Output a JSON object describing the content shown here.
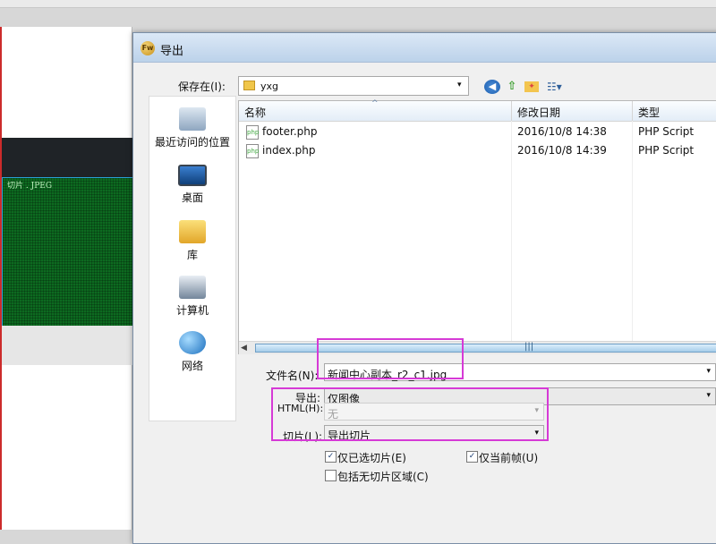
{
  "app": {
    "slice_label": "切片 . JPEG"
  },
  "dialog": {
    "title": "导出",
    "logo_text": "Fw",
    "save_in": {
      "label": "保存在(I):",
      "value": "yxg",
      "arrow": "▾"
    },
    "toolbar": {
      "back_icon": "back-icon",
      "up_icon": "up-folder-icon",
      "new_folder_icon": "new-folder-icon",
      "views_icon": "views-menu-icon",
      "back_glyph": "◀",
      "up_glyph": "⇧",
      "new_folder_glyph": "✦",
      "views_glyph": "☷▾"
    },
    "places": [
      {
        "label": "最近访问的位置",
        "icon": "recent-places-icon"
      },
      {
        "label": "桌面",
        "icon": "desktop-icon"
      },
      {
        "label": "库",
        "icon": "library-icon"
      },
      {
        "label": "计算机",
        "icon": "computer-icon"
      },
      {
        "label": "网络",
        "icon": "network-icon"
      }
    ],
    "file_list": {
      "columns": [
        "名称",
        "修改日期",
        "类型"
      ],
      "sort_glyph": "^",
      "rows": [
        {
          "name": "footer.php",
          "modified": "2016/10/8 14:38",
          "type": "PHP Script"
        },
        {
          "name": "index.php",
          "modified": "2016/10/8 14:39",
          "type": "PHP Script"
        }
      ],
      "file_glyph": "php",
      "scroll_left": "◀",
      "scroll_grip": "|||"
    },
    "filename": {
      "label": "文件名(N):",
      "value": "新闻中心副本_r2_c1.jpg",
      "arrow": "▾"
    },
    "export": {
      "label": "导出:",
      "value": "仅图像",
      "arrow": "▾"
    },
    "html": {
      "label": "HTML(H):",
      "value": "无",
      "arrow": "▾"
    },
    "slices": {
      "label": "切片(L):",
      "value": "导出切片",
      "arrow": "▾"
    },
    "checkboxes": {
      "selected_slices_only": {
        "label": "仅已选切片(E)",
        "checked": true
      },
      "current_frame_only": {
        "label": "仅当前帧(U)",
        "checked": true
      },
      "include_areas_without_slices": {
        "label": "包括无切片区域(C)",
        "checked": false
      }
    },
    "check_glyph": "✓",
    "highlight_color": "#d63ad6"
  }
}
